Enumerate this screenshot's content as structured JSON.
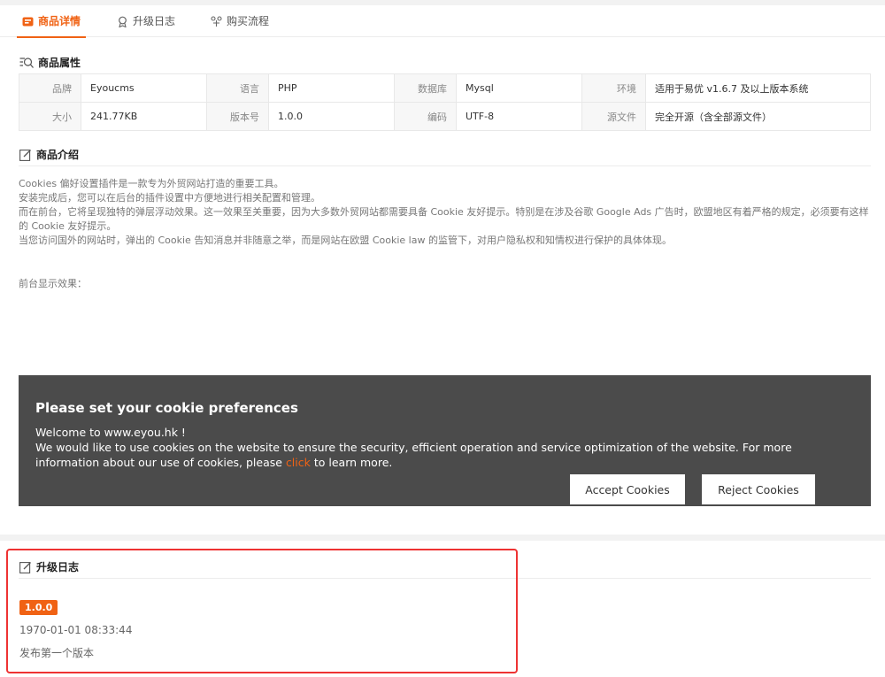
{
  "tabs": [
    {
      "label": "商品详情",
      "icon": "product-icon",
      "active": true
    },
    {
      "label": "升级日志",
      "icon": "badge-icon",
      "active": false
    },
    {
      "label": "购买流程",
      "icon": "flow-icon",
      "active": false
    }
  ],
  "attributes": {
    "title": "商品属性",
    "rows": [
      [
        {
          "key": "品牌",
          "value": "Eyoucms"
        },
        {
          "key": "语言",
          "value": "PHP"
        },
        {
          "key": "数据库",
          "value": "Mysql"
        },
        {
          "key": "环境",
          "value": "适用于易优 v1.6.7 及以上版本系统"
        }
      ],
      [
        {
          "key": "大小",
          "value": "241.77KB"
        },
        {
          "key": "版本号",
          "value": "1.0.0"
        },
        {
          "key": "编码",
          "value": "UTF-8"
        },
        {
          "key": "源文件",
          "value": "完全开源（含全部源文件）"
        }
      ]
    ]
  },
  "intro": {
    "title": "商品介绍",
    "paragraphs": [
      "Cookies 偏好设置插件是一款专为外贸网站打造的重要工具。",
      "安装完成后，您可以在后台的插件设置中方便地进行相关配置和管理。",
      "而在前台，它将呈现独特的弹层浮动效果。这一效果至关重要，因为大多数外贸网站都需要具备 Cookie 友好提示。特别是在涉及谷歌 Google Ads 广告时，欧盟地区有着严格的规定，必须要有这样的 Cookie 友好提示。",
      "当您访问国外的网站时，弹出的 Cookie 告知消息并非随意之举，而是网站在欧盟 Cookie law 的监管下，对用户隐私权和知情权进行保护的具体体现。"
    ],
    "preview_label": "前台显示效果："
  },
  "cookie_banner": {
    "title": "Please set your cookie preferences",
    "welcome": "Welcome to www.eyou.hk !",
    "message_before": "We would like to use cookies on the website to ensure the security, efficient operation and service optimization of the website. For more information about our use of cookies, please ",
    "link_text": "click",
    "message_after": " to learn more.",
    "accept_label": "Accept Cookies",
    "reject_label": "Reject Cookies",
    "bg_color": "#4b4b4b",
    "link_color": "#f06214"
  },
  "changelog": {
    "title": "升级日志",
    "version": "1.0.0",
    "date": "1970-01-01 08:33:44",
    "note": "发布第一个版本"
  },
  "colors": {
    "accent": "#f06214",
    "highlight_box": "#e33333"
  }
}
